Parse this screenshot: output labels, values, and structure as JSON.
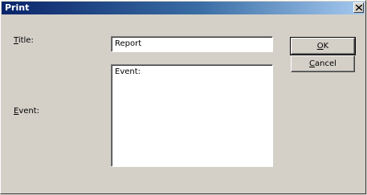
{
  "window": {
    "title": "Print",
    "close_glyph": "×"
  },
  "form": {
    "title_label_mnemonic": "T",
    "title_label_rest": "itle:",
    "title_value": "Report",
    "event_label_mnemonic": "E",
    "event_label_rest": "vent:",
    "event_value": "Event:"
  },
  "buttons": {
    "ok_mnemonic": "O",
    "ok_rest": "K",
    "cancel_mnemonic": "C",
    "cancel_rest": "ancel"
  }
}
